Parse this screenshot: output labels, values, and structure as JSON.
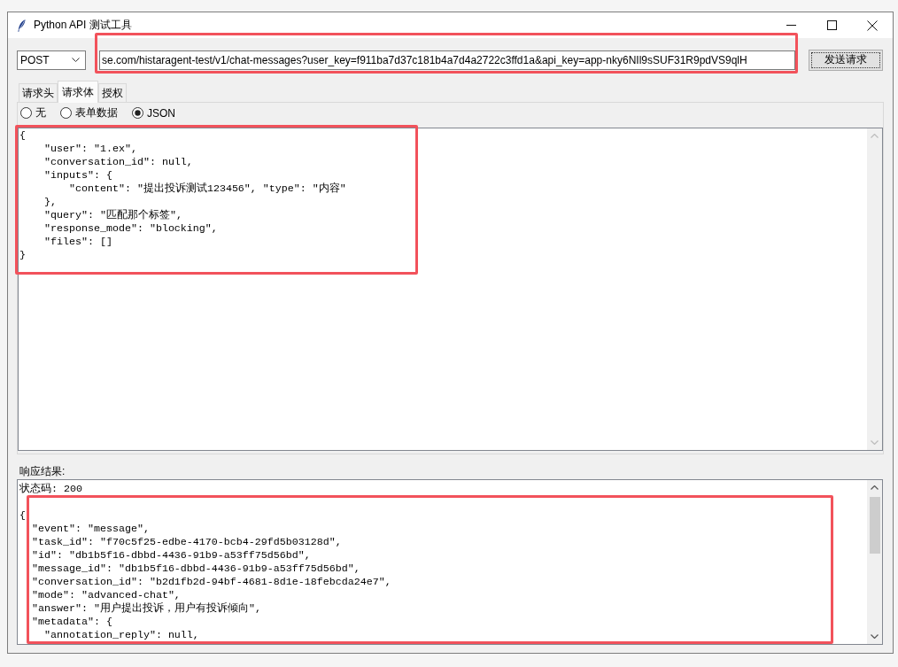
{
  "window": {
    "title": "Python API 测试工具"
  },
  "request": {
    "method": "POST",
    "url": "se.com/histaragent-test/v1/chat-messages?user_key=f911ba7d37c181b4a7d4a2722c3ffd1a&api_key=app-nky6NIl9sSUF31R9pdVS9qlH",
    "send_button": "发送请求"
  },
  "tabs": [
    {
      "label": "请求头",
      "selected": false
    },
    {
      "label": "请求体",
      "selected": true
    },
    {
      "label": "授权",
      "selected": false
    }
  ],
  "body_types": [
    {
      "label": "无",
      "selected": false
    },
    {
      "label": "表单数据",
      "selected": false
    },
    {
      "label": "JSON",
      "selected": true
    }
  ],
  "body_text": [
    "{",
    "    \"user\": \"1.ex\",",
    "    \"conversation_id\": null,",
    "    \"inputs\": {",
    "        \"content\": \"提出投诉测试123456\", \"type\": \"内容\"",
    "    },",
    "    \"query\": \"匹配那个标签\",",
    "    \"response_mode\": \"blocking\",",
    "    \"files\": []",
    "}"
  ],
  "response": {
    "label": "响应结果:",
    "status": "状态码: 200",
    "lines": [
      "{",
      "  \"event\": \"message\",",
      "  \"task_id\": \"f70c5f25-edbe-4170-bcb4-29fd5b03128d\",",
      "  \"id\": \"db1b5f16-dbbd-4436-91b9-a53ff75d56bd\",",
      "  \"message_id\": \"db1b5f16-dbbd-4436-91b9-a53ff75d56bd\",",
      "  \"conversation_id\": \"b2d1fb2d-94bf-4681-8d1e-18febcda24e7\",",
      "  \"mode\": \"advanced-chat\",",
      "  \"answer\": \"用户提出投诉，用户有投诉倾向\",",
      "  \"metadata\": {",
      "    \"annotation_reply\": null,"
    ]
  }
}
